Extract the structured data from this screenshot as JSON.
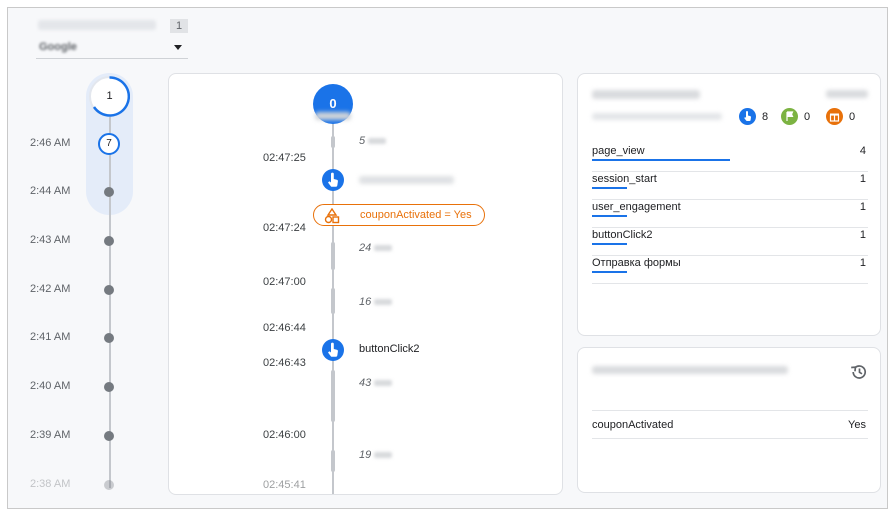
{
  "selector": {
    "count": "1",
    "value": "Google"
  },
  "timeline": {
    "session_count": "1",
    "rows": [
      {
        "time": "2:46 AM",
        "marker": "7"
      },
      {
        "time": "2:44 AM"
      },
      {
        "time": "2:43 AM"
      },
      {
        "time": "2:42 AM"
      },
      {
        "time": "2:41 AM"
      },
      {
        "time": "2:40 AM"
      },
      {
        "time": "2:39 AM"
      },
      {
        "time": "2:38 AM"
      }
    ]
  },
  "stream": {
    "top_count": "0",
    "times": [
      "02:47:25",
      "02:47:24",
      "02:47:00",
      "02:46:44",
      "02:46:43",
      "02:46:00",
      "02:45:41"
    ],
    "durations": [
      "5",
      "24",
      "16",
      "43",
      "19"
    ],
    "property": "couponActivated = Yes",
    "event_label": "buttonClick2"
  },
  "top_events": {
    "stats": [
      {
        "icon": "touch-icon",
        "count": "8",
        "color": "#1a73e8"
      },
      {
        "icon": "flag-icon",
        "count": "0",
        "color": "#7cb342"
      },
      {
        "icon": "gift-icon",
        "count": "0",
        "color": "#e8710a"
      }
    ],
    "rows": [
      {
        "name": "page_view",
        "count": "4",
        "share": 0.5
      },
      {
        "name": "session_start",
        "count": "1",
        "share": 0.125
      },
      {
        "name": "user_engagement",
        "count": "1",
        "share": 0.125
      },
      {
        "name": "buttonClick2",
        "count": "1",
        "share": 0.125
      },
      {
        "name": "Отправка формы",
        "count": "1",
        "share": 0.125
      }
    ]
  },
  "user_properties": {
    "rows": [
      {
        "name": "couponActivated",
        "value": "Yes"
      }
    ]
  },
  "colors": {
    "accent": "#1a73e8",
    "conversion": "#e8710a",
    "dot": "#757a80"
  }
}
